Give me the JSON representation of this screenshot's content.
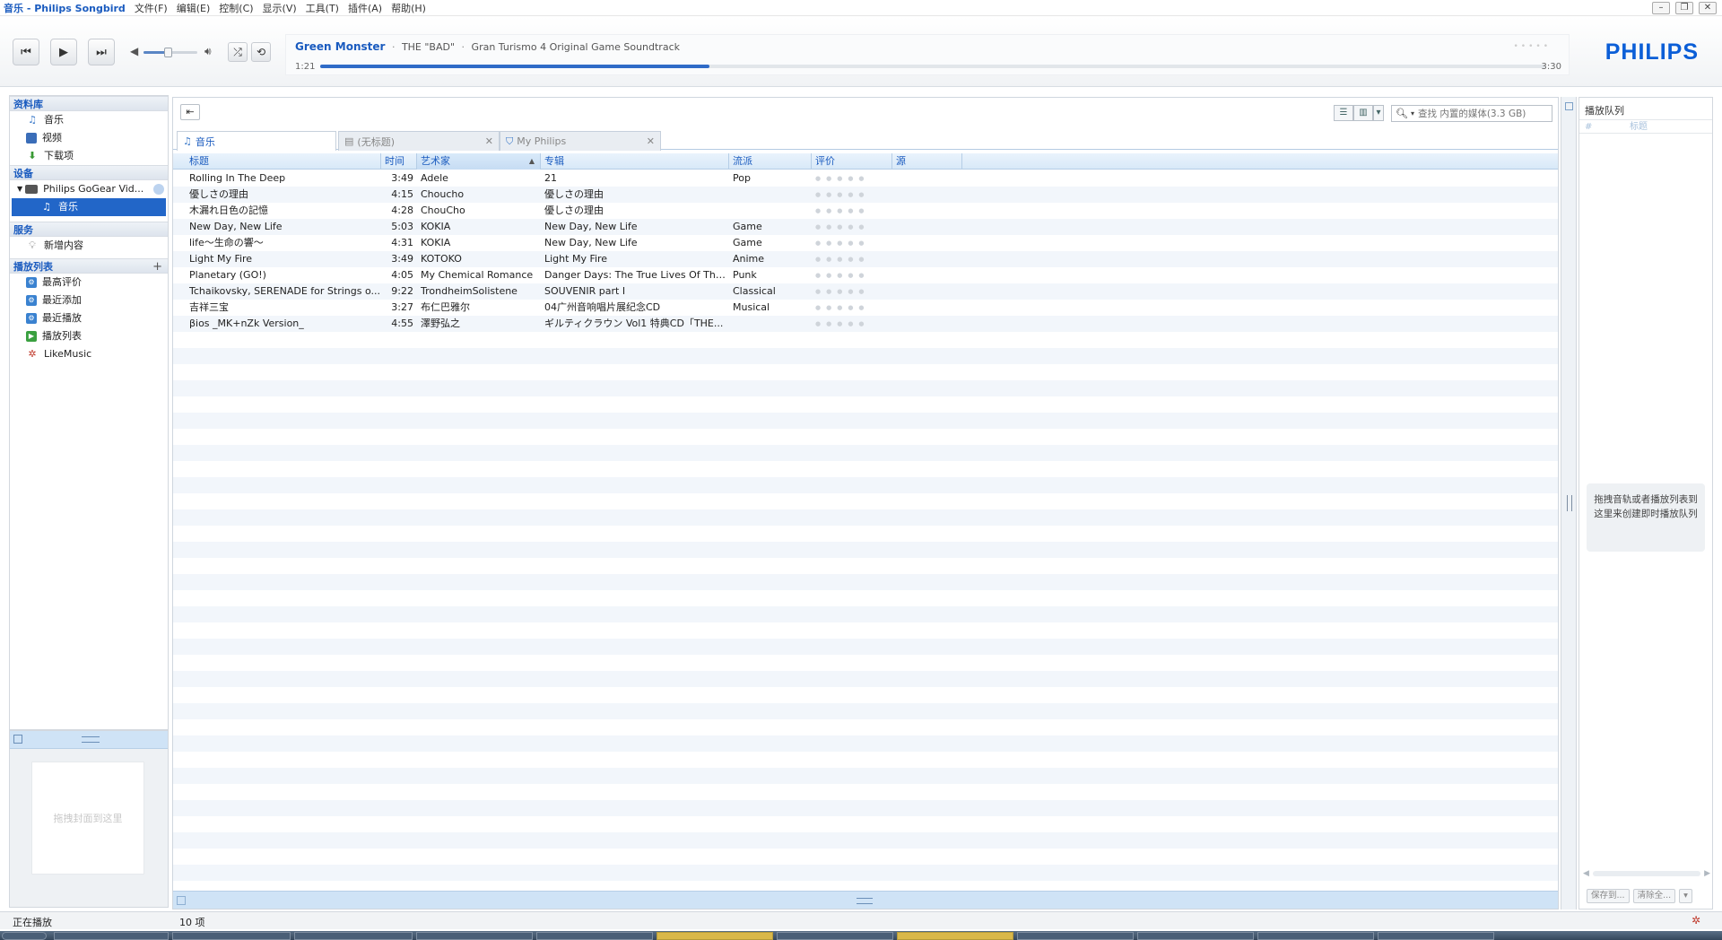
{
  "window": {
    "title": "音乐 - Philips Songbird",
    "menu": [
      "文件(F)",
      "编辑(E)",
      "控制(C)",
      "显示(V)",
      "工具(T)",
      "插件(A)",
      "帮助(H)"
    ],
    "controls": [
      "–",
      "❐",
      "✕"
    ]
  },
  "player": {
    "prev_icon": "prev-track-icon",
    "play_icon": "play-icon",
    "next_icon": "next-track-icon",
    "volume_fraction": 0.45,
    "shuffle_icon": "shuffle-icon",
    "repeat_icon": "repeat-icon",
    "now_playing": {
      "title": "Green Monster",
      "artist": "THE \"BAD\"",
      "album": "Gran Turismo 4 Original Game Soundtrack",
      "elapsed": "1:21",
      "duration": "3:30",
      "progress_fraction": 0.318
    },
    "brand": "PHILIPS"
  },
  "sidebar": {
    "sections": [
      {
        "title": "资料库",
        "items": [
          {
            "label": "音乐",
            "icon": "music-note-icon"
          },
          {
            "label": "视频",
            "icon": "video-icon"
          },
          {
            "label": "下载项",
            "icon": "download-icon"
          }
        ]
      },
      {
        "title": "设备",
        "items": [
          {
            "label": "Philips GoGear Vid...",
            "icon": "device-icon"
          },
          {
            "label": "音乐",
            "icon": "music-note-icon",
            "selected": true
          }
        ]
      },
      {
        "title": "服务",
        "items": [
          {
            "label": "新增内容",
            "icon": "lightbulb-icon"
          }
        ]
      },
      {
        "title": "播放列表",
        "items": [
          {
            "label": "最高评价",
            "icon": "smart-playlist-icon"
          },
          {
            "label": "最近添加",
            "icon": "smart-playlist-icon"
          },
          {
            "label": "最近播放",
            "icon": "smart-playlist-icon"
          },
          {
            "label": "播放列表",
            "icon": "playlist-icon"
          },
          {
            "label": "LikeMusic",
            "icon": "likemusic-icon"
          }
        ]
      }
    ],
    "art_placeholder": "拖拽封面到这里"
  },
  "main": {
    "search_placeholder": "查找 内置的媒体(3.3 GB)",
    "tabs": [
      {
        "label": "音乐",
        "active": true
      },
      {
        "label": "(无标题)",
        "active": false
      },
      {
        "label": "My Philips",
        "active": false
      }
    ],
    "columns": [
      "标题",
      "时间",
      "艺术家",
      "专辑",
      "流派",
      "评价",
      "源"
    ],
    "tracks": [
      {
        "title": "Rolling In The Deep",
        "time": "3:49",
        "artist": "Adele",
        "album": "21",
        "genre": "Pop"
      },
      {
        "title": "優しさの理由",
        "time": "4:15",
        "artist": "Choucho",
        "album": "優しさの理由",
        "genre": ""
      },
      {
        "title": "木漏れ日色の記憶",
        "time": "4:28",
        "artist": "ChouCho",
        "album": "優しさの理由",
        "genre": ""
      },
      {
        "title": "New Day, New Life",
        "time": "5:03",
        "artist": "KOKIA",
        "album": "New Day, New Life",
        "genre": "Game"
      },
      {
        "title": "life～生命の響～",
        "time": "4:31",
        "artist": "KOKIA",
        "album": "New Day, New Life",
        "genre": "Game"
      },
      {
        "title": "Light My Fire",
        "time": "3:49",
        "artist": "KOTOKO",
        "album": "Light My Fire",
        "genre": "Anime"
      },
      {
        "title": "Planetary (GO!)",
        "time": "4:05",
        "artist": "My Chemical Romance",
        "album": "Danger Days: The True Lives Of The ...",
        "genre": "Punk"
      },
      {
        "title": "Tchaikovsky, SERENADE for Strings o...",
        "time": "9:22",
        "artist": "TrondheimSolistene",
        "album": "SOUVENIR part I",
        "genre": "Classical"
      },
      {
        "title": "吉祥三宝",
        "time": "3:27",
        "artist": "布仁巴雅尔",
        "album": "04广州音响唱片展纪念CD",
        "genre": "Musical"
      },
      {
        "title": "βios _MK+nZk Version_",
        "time": "4:55",
        "artist": "澤野弘之",
        "album": "ギルティクラウン Vol1 特典CD「THE...",
        "genre": ""
      }
    ]
  },
  "queue": {
    "title": "播放队列",
    "columns": [
      "#",
      "标题"
    ],
    "empty_hint": "拖拽音轨或者播放列表到这里来创建即时播放队列",
    "save_label": "保存到...",
    "clear_label": "清除全..."
  },
  "status": {
    "left": "正在播放",
    "count": "10 项"
  }
}
